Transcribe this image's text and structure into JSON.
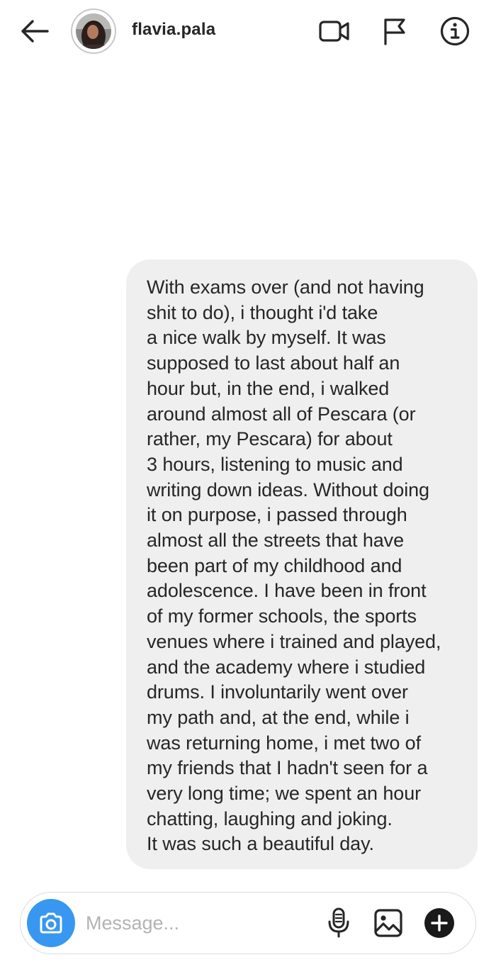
{
  "header": {
    "username": "flavia.pala",
    "icons": {
      "back": "back-arrow-icon",
      "avatar": "profile-avatar",
      "video": "video-call-icon",
      "flag": "flag-icon",
      "info": "info-icon"
    }
  },
  "conversation": {
    "messages": [
      {
        "direction": "outgoing",
        "text": "With exams over (and not having\nshit to do), i thought i'd take\na nice walk by myself. It was\nsupposed to last about half an\nhour but, in the end, i walked\naround almost all of Pescara (or\nrather, my Pescara) for about\n3 hours, listening to music and\nwriting down ideas. Without doing\nit on purpose, i passed through\nalmost all the streets that have\nbeen part of my childhood and\nadolescence. I have been in front\nof my former schools, the sports\nvenues where i trained and played,\nand the academy where i studied\ndrums. I involuntarily went over\nmy path and, at the end, while i\nwas returning home, i met two of\nmy friends that I hadn't seen for a\nvery long time; we spent an hour\nchatting, laughing and joking.\nIt was such a beautiful day."
      }
    ]
  },
  "composer": {
    "placeholder": "Message...",
    "value": "",
    "icons": {
      "camera": "camera-icon",
      "mic": "microphone-icon",
      "gallery": "gallery-icon",
      "plus": "plus-icon"
    }
  },
  "colors": {
    "accent": "#3897f0",
    "bubble": "#efefef",
    "text": "#262626",
    "placeholder": "#b3b3b3",
    "border": "#dbdbdb"
  }
}
